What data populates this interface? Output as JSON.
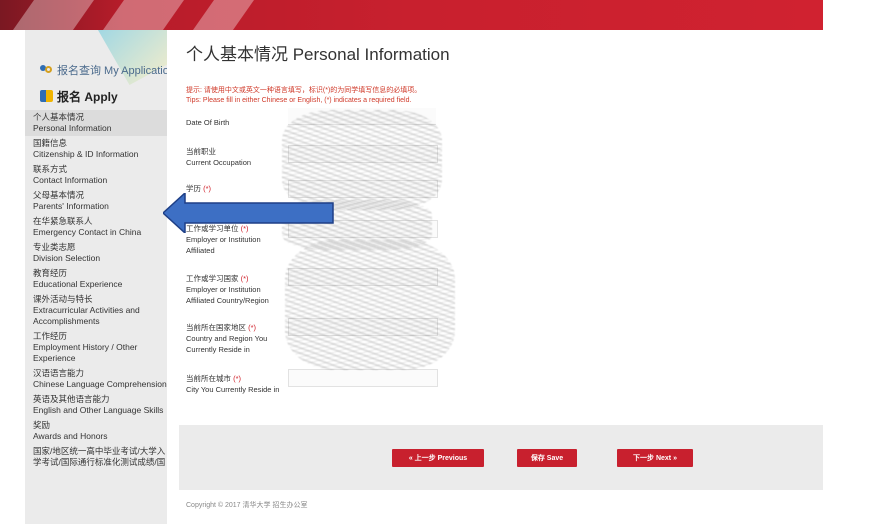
{
  "sidebar": {
    "my_application": "报名查询 My Application",
    "apply": "报名 Apply",
    "items": [
      {
        "cn": "个人基本情况",
        "en": "Personal Information"
      },
      {
        "cn": "国籍信息",
        "en": "Citizenship & ID Information"
      },
      {
        "cn": "联系方式",
        "en": "Contact Information"
      },
      {
        "cn": "父母基本情况",
        "en": "Parents' Information"
      },
      {
        "cn": "在华紧急联系人",
        "en": "Emergency Contact in China"
      },
      {
        "cn": "专业类志愿",
        "en": "Division Selection"
      },
      {
        "cn": "教育经历",
        "en": "Educational Experience"
      },
      {
        "cn": "课外活动与特长",
        "en": "Extracurricular Activities and Accomplishments"
      },
      {
        "cn": "工作经历",
        "en": "Employment History / Other Experience"
      },
      {
        "cn": "汉语语言能力",
        "en": "Chinese Language Comprehension"
      },
      {
        "cn": "英语及其他语言能力",
        "en": "English and Other Language Skills"
      },
      {
        "cn": "奖励",
        "en": "Awards and Honors"
      },
      {
        "cn": "国家/地区统一高中毕业考试/大学入",
        "en": "学考试/国际通行标准化测试成绩/国"
      }
    ]
  },
  "main": {
    "title": "个人基本情况 Personal Information",
    "tip_cn": "提示: 请使用中文或英文一种语言填写，标识(*)的为同学填写信息的必填项。",
    "tip_en": "Tips: Please fill in either Chinese or English, (*) indicates a required field.",
    "required_mark": "(*)",
    "fields": {
      "dob": {
        "en": "Date Of Birth"
      },
      "occupation": {
        "cn": "当前职业",
        "en": "Current Occupation"
      },
      "education": {
        "cn": "学历",
        "en": ""
      },
      "employer": {
        "cn": "工作或学习单位",
        "en1": "Employer or Institution",
        "en2": "Affiliated"
      },
      "employer_country": {
        "cn": "工作或学习国家",
        "en1": "Employer or Institution",
        "en2": "Affiliated Country/Region"
      },
      "reside_country": {
        "cn": "当前所在国家地区",
        "en1": "Country and Region You",
        "en2": "Currently Reside in"
      },
      "reside_city": {
        "cn": "当前所在城市",
        "en": "City You Currently Reside in"
      }
    }
  },
  "buttons": {
    "previous": "« 上一步 Previous",
    "save": "保存 Save",
    "next": "下一步 Next »"
  },
  "footer": {
    "copyright": "Copyright © 2017 清华大学 招生办公室"
  },
  "colors": {
    "brand_red": "#c8202e",
    "arrow_blue": "#3d6fc4",
    "tip_red": "#d03a2a"
  },
  "icons": {
    "my_application": "people-search-icon",
    "apply": "document-icon",
    "annotation": "left-arrow"
  }
}
